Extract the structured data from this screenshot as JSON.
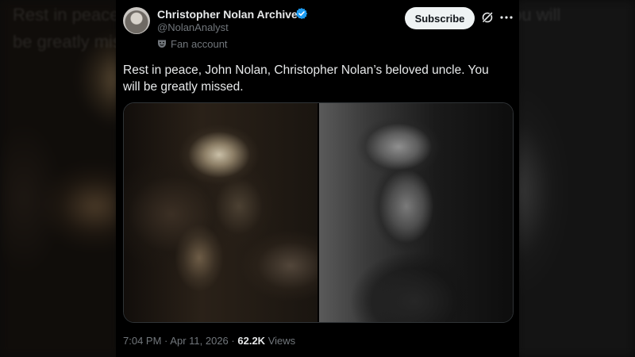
{
  "background": {
    "blurred_text_line1": "Rest in peace, John Nolan, Christopher Nolan's beloved uncle. You will",
    "blurred_text_line2": "be greatly missed."
  },
  "tweet": {
    "display_name": "Christopher Nolan Archives",
    "handle": "@NolanAnalyst",
    "account_label": "Fan account",
    "subscribe_label": "Subscribe",
    "text": "Rest in peace, John Nolan, Christopher Nolan’s beloved uncle. You will be greatly missed.",
    "time": "7:04 PM",
    "separator": "·",
    "date": "Apr 11, 2026",
    "views_count": "62.2K",
    "views_label": "Views"
  },
  "icons": {
    "verified": "verified-badge-icon",
    "fan": "theater-masks-icon",
    "grok": "grok-icon",
    "more": "more-icon"
  },
  "colors": {
    "card_bg": "#000000",
    "primary_text": "#e7e9ea",
    "secondary_text": "#71767b",
    "verified_blue": "#1d9bf0",
    "subscribe_bg": "#eff3f4"
  }
}
